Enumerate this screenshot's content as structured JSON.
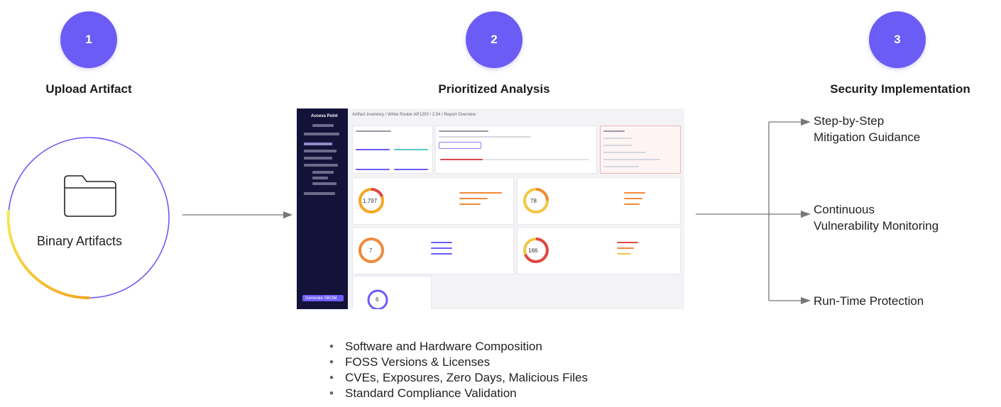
{
  "steps": [
    {
      "number": "1",
      "title": "Upload Artifact"
    },
    {
      "number": "2",
      "title": "Prioritized Analysis"
    },
    {
      "number": "3",
      "title": "Security Implementation"
    }
  ],
  "artifact": {
    "label": "Binary Artifacts",
    "icon": "folder-icon"
  },
  "outcomes": [
    {
      "line1": "Step-by-Step",
      "line2": "Mitigation Guidance"
    },
    {
      "line1": "Continuous",
      "line2": "Vulnerability Monitoring"
    },
    {
      "line1": "Run-Time Protection",
      "line2": ""
    }
  ],
  "analysis_points": [
    "Software and Hardware Composition",
    "FOSS Versions & Licenses",
    "CVEs, Exposures, Zero Days, Malicious Files",
    "Standard Compliance Validation"
  ],
  "dashboard": {
    "breadcrumb": "Artifact Inventory  /  White Router AP1200  /  2.54  /  Report Overview",
    "sidebar_title": "Access Point",
    "cves_total": "1,797",
    "exposures_total": "78",
    "zero_days_total": "7",
    "license_total": "166",
    "sbom_total": "6",
    "generate_button": "Generate SBOM"
  },
  "colors": {
    "accent": "#6b5cf6",
    "ring_yellow": "#f2e04d",
    "ring_orange": "#f5a623",
    "ring_purple": "#6b5cf6"
  }
}
